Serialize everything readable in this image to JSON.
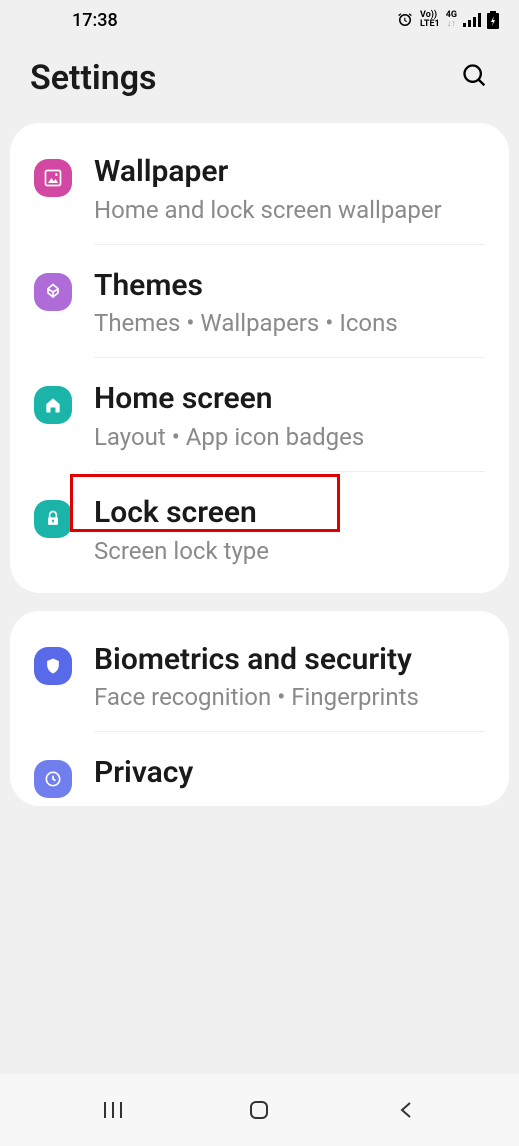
{
  "status": {
    "time": "17:38",
    "network_top": "Vo))",
    "network_bottom": "LTE1",
    "cellular": "4G"
  },
  "header": {
    "title": "Settings"
  },
  "groups": [
    {
      "items": [
        {
          "title": "Wallpaper",
          "subtitle": "Home and lock screen wallpaper",
          "icon": "wallpaper"
        },
        {
          "title": "Themes",
          "subtitle": "Themes  •  Wallpapers  •  Icons",
          "icon": "themes"
        },
        {
          "title": "Home screen",
          "subtitle": "Layout  •  App icon badges",
          "icon": "home"
        },
        {
          "title": "Lock screen",
          "subtitle": "Screen lock type",
          "icon": "lock",
          "highlighted": true
        }
      ]
    },
    {
      "items": [
        {
          "title": "Biometrics and security",
          "subtitle": "Face recognition  •  Fingerprints",
          "icon": "biometrics"
        },
        {
          "title": "Privacy",
          "subtitle": "",
          "icon": "privacy"
        }
      ]
    }
  ]
}
